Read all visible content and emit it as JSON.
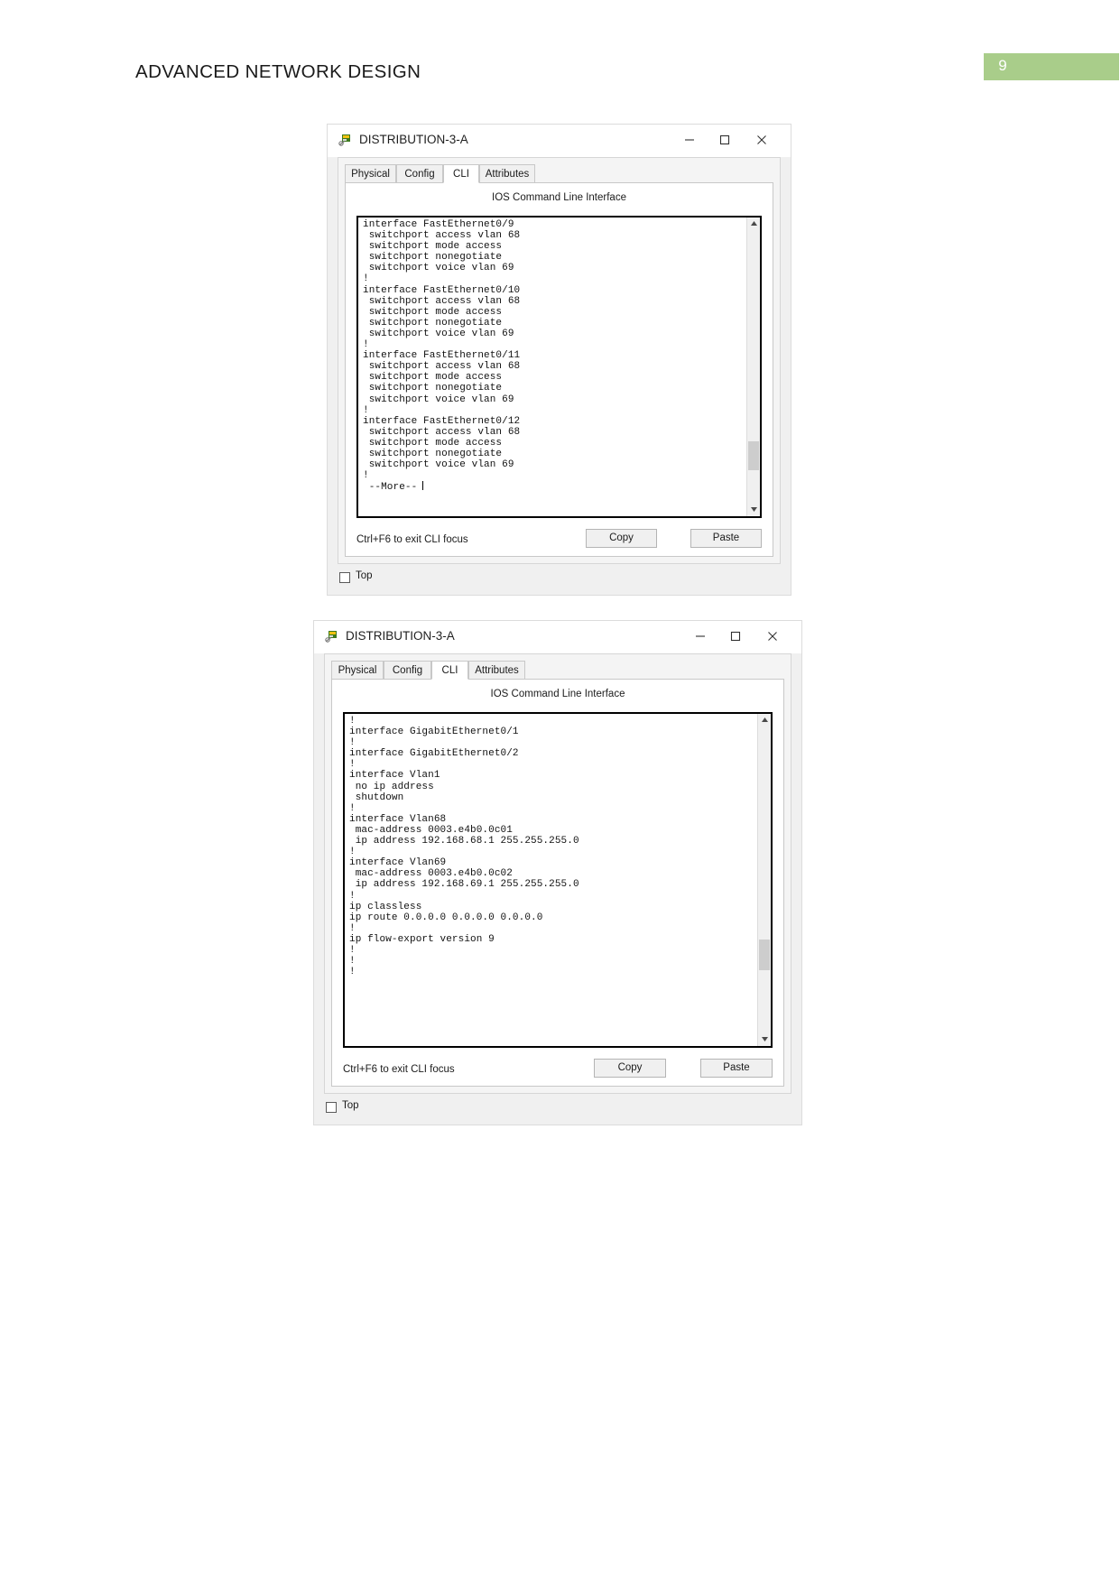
{
  "document": {
    "header_title": "ADVANCED NETWORK DESIGN",
    "page_number": "9",
    "badge_color": "#a9cd8a"
  },
  "windows": [
    {
      "title": "DISTRIBUTION-3-A",
      "icon": "packet-tracer-switch-icon",
      "controls": {
        "minimize": "minimize-icon",
        "maximize": "maximize-icon",
        "close": "close-icon"
      },
      "tabs": [
        {
          "label": "Physical",
          "active": false
        },
        {
          "label": "Config",
          "active": false
        },
        {
          "label": "CLI",
          "active": true
        },
        {
          "label": "Attributes",
          "active": false
        }
      ],
      "panel_heading": "IOS Command Line Interface",
      "console_text": "interface FastEthernet0/9\n switchport access vlan 68\n switchport mode access\n switchport nonegotiate\n switchport voice vlan 69\n!\ninterface FastEthernet0/10\n switchport access vlan 68\n switchport mode access\n switchport nonegotiate\n switchport voice vlan 69\n!\ninterface FastEthernet0/11\n switchport access vlan 68\n switchport mode access\n switchport nonegotiate\n switchport voice vlan 69\n!\ninterface FastEthernet0/12\n switchport access vlan 68\n switchport mode access\n switchport nonegotiate\n switchport voice vlan 69\n!\n --More--",
      "hint": "Ctrl+F6 to exit CLI focus",
      "copy_label": "Copy",
      "paste_label": "Paste",
      "top_checkbox_label": "Top",
      "top_checkbox_checked": false
    },
    {
      "title": "DISTRIBUTION-3-A",
      "icon": "packet-tracer-switch-icon",
      "controls": {
        "minimize": "minimize-icon",
        "maximize": "maximize-icon",
        "close": "close-icon"
      },
      "tabs": [
        {
          "label": "Physical",
          "active": false
        },
        {
          "label": "Config",
          "active": false
        },
        {
          "label": "CLI",
          "active": true
        },
        {
          "label": "Attributes",
          "active": false
        }
      ],
      "panel_heading": "IOS Command Line Interface",
      "console_text": "!\ninterface GigabitEthernet0/1\n!\ninterface GigabitEthernet0/2\n!\ninterface Vlan1\n no ip address\n shutdown\n!\ninterface Vlan68\n mac-address 0003.e4b0.0c01\n ip address 192.168.68.1 255.255.255.0\n!\ninterface Vlan69\n mac-address 0003.e4b0.0c02\n ip address 192.168.69.1 255.255.255.0\n!\nip classless\nip route 0.0.0.0 0.0.0.0 0.0.0.0\n!\nip flow-export version 9\n!\n!\n!",
      "hint": "Ctrl+F6 to exit CLI focus",
      "copy_label": "Copy",
      "paste_label": "Paste",
      "top_checkbox_label": "Top",
      "top_checkbox_checked": false
    }
  ]
}
